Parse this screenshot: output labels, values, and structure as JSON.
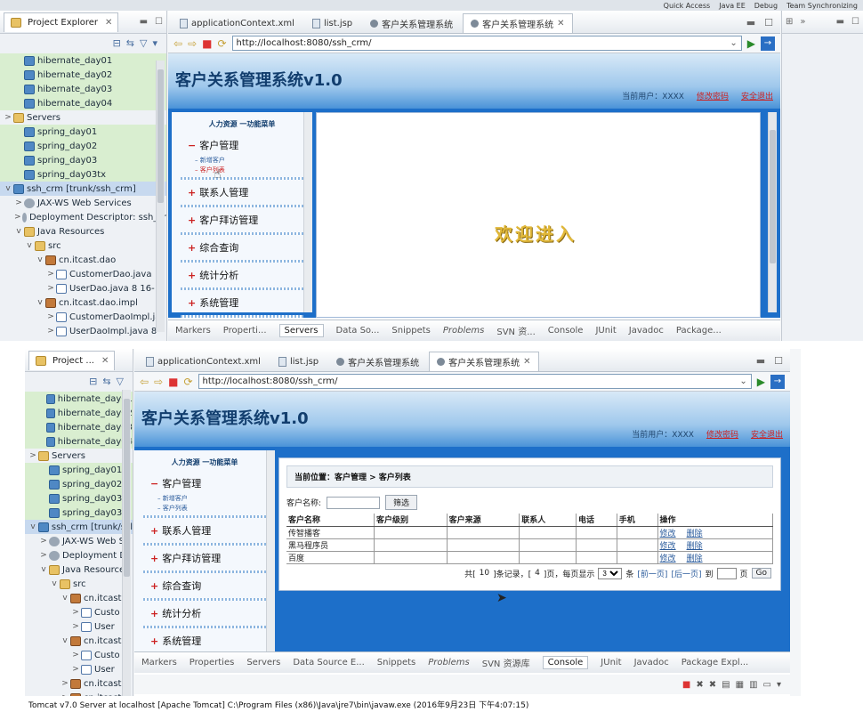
{
  "top_strip": {
    "quick_access": "Quick Access",
    "perspective1": "Java EE",
    "perspective2": "Debug",
    "perspective3": "Team Synchronizing"
  },
  "explorer": {
    "title1": "Project Explorer",
    "title2": "Project ...",
    "items": [
      {
        "label": "hibernate_day01",
        "depth": 1,
        "icon": "proj"
      },
      {
        "label": "hibernate_day02",
        "depth": 1,
        "icon": "proj"
      },
      {
        "label": "hibernate_day03",
        "depth": 1,
        "icon": "proj"
      },
      {
        "label": "hibernate_day04",
        "depth": 1,
        "icon": "proj"
      },
      {
        "label": "Servers",
        "depth": 0,
        "icon": "fold",
        "toggle": ">"
      },
      {
        "label": "spring_day01",
        "depth": 1,
        "icon": "proj"
      },
      {
        "label": "spring_day02",
        "depth": 1,
        "icon": "proj"
      },
      {
        "label": "spring_day03",
        "depth": 1,
        "icon": "proj"
      },
      {
        "label": "spring_day03tx",
        "depth": 1,
        "icon": "proj"
      },
      {
        "label": "ssh_crm [trunk/ssh_crm]",
        "depth": 0,
        "icon": "proj",
        "toggle": "v",
        "sel": true
      },
      {
        "label": "JAX-WS Web Services",
        "depth": 1,
        "icon": "gear",
        "toggle": ">"
      },
      {
        "label": "Deployment Descriptor: ssh_cr",
        "depth": 1,
        "icon": "gear",
        "toggle": ">"
      },
      {
        "label": "Java Resources",
        "depth": 1,
        "icon": "fold",
        "toggle": "v"
      },
      {
        "label": "src",
        "depth": 2,
        "icon": "fold",
        "toggle": "v"
      },
      {
        "label": "cn.itcast.dao",
        "depth": 3,
        "icon": "pkg",
        "toggle": "v"
      },
      {
        "label": "CustomerDao.java",
        "depth": 4,
        "icon": "java",
        "toggle": ">"
      },
      {
        "label": "UserDao.java 8  16-",
        "depth": 4,
        "icon": "java",
        "toggle": ">"
      },
      {
        "label": "cn.itcast.dao.impl",
        "depth": 3,
        "icon": "pkg",
        "toggle": "v"
      },
      {
        "label": "CustomerDaoImpl.ja",
        "depth": 4,
        "icon": "java",
        "toggle": ">"
      },
      {
        "label": "UserDaoImpl.java 8",
        "depth": 4,
        "icon": "java",
        "toggle": ">"
      },
      {
        "label": "cn.itcast.domain",
        "depth": 3,
        "icon": "pkg",
        "toggle": ">"
      }
    ],
    "items2": [
      {
        "label": "hibernate_day01",
        "depth": 1,
        "icon": "proj"
      },
      {
        "label": "hibernate_day02",
        "depth": 1,
        "icon": "proj"
      },
      {
        "label": "hibernate_day03",
        "depth": 1,
        "icon": "proj"
      },
      {
        "label": "hibernate_day04",
        "depth": 1,
        "icon": "proj"
      },
      {
        "label": "Servers",
        "depth": 0,
        "icon": "fold",
        "toggle": ">"
      },
      {
        "label": "spring_day01",
        "depth": 1,
        "icon": "proj"
      },
      {
        "label": "spring_day02",
        "depth": 1,
        "icon": "proj"
      },
      {
        "label": "spring_day03",
        "depth": 1,
        "icon": "proj"
      },
      {
        "label": "spring_day03tx",
        "depth": 1,
        "icon": "proj"
      },
      {
        "label": "ssh_crm [trunk/ssl",
        "depth": 0,
        "icon": "proj",
        "toggle": "v",
        "sel": true
      },
      {
        "label": "JAX-WS Web S",
        "depth": 1,
        "icon": "gear",
        "toggle": ">"
      },
      {
        "label": "Deployment D",
        "depth": 1,
        "icon": "gear",
        "toggle": ">"
      },
      {
        "label": "Java Resource",
        "depth": 1,
        "icon": "fold",
        "toggle": "v"
      },
      {
        "label": "src",
        "depth": 2,
        "icon": "fold",
        "toggle": "v"
      },
      {
        "label": "cn.itcast",
        "depth": 3,
        "icon": "pkg",
        "toggle": "v"
      },
      {
        "label": "Custo",
        "depth": 4,
        "icon": "java",
        "toggle": ">"
      },
      {
        "label": "User",
        "depth": 4,
        "icon": "java",
        "toggle": ">"
      },
      {
        "label": "cn.itcast",
        "depth": 3,
        "icon": "pkg",
        "toggle": "v"
      },
      {
        "label": "Custo",
        "depth": 4,
        "icon": "java",
        "toggle": ">"
      },
      {
        "label": "User",
        "depth": 4,
        "icon": "java",
        "toggle": ">"
      },
      {
        "label": "cn.itcast",
        "depth": 3,
        "icon": "pkg",
        "toggle": ">"
      },
      {
        "label": "cn.itcast",
        "depth": 3,
        "icon": "pkg",
        "toggle": ">"
      }
    ]
  },
  "editor": {
    "tabs": [
      {
        "label": "applicationContext.xml",
        "type": "doc"
      },
      {
        "label": "list.jsp",
        "type": "doc"
      },
      {
        "label": "客户关系管理系统",
        "type": "dot"
      },
      {
        "label": "客户关系管理系统",
        "type": "dot",
        "active": true
      }
    ],
    "url1": "http://localhost:8080/ssh_crm/",
    "url2": "http://localhost:8080/ssh_crm/"
  },
  "crm": {
    "title": "客户关系管理系统v1.0",
    "current_user": "当前用户：XXXX",
    "change_pwd": "修改密码",
    "logout": "安全退出",
    "menu_title": "人力资源 一功能菜单",
    "groups": [
      {
        "label": "客户管理",
        "sign": "−",
        "subs": [
          "新增客户",
          "客户列表"
        ]
      },
      {
        "label": "联系人管理",
        "sign": "+"
      },
      {
        "label": "客户拜访管理",
        "sign": "+"
      },
      {
        "label": "综合查询",
        "sign": "+"
      },
      {
        "label": "统计分析",
        "sign": "+"
      },
      {
        "label": "系统管理",
        "sign": "+"
      }
    ],
    "welcome": "欢迎进入",
    "crumb": "当前位置：客户管理 > 客户列表",
    "search_label": "客户名称:",
    "search_btn": "筛选",
    "columns": [
      "客户名称",
      "客户级别",
      "客户来源",
      "联系人",
      "电话",
      "手机",
      "操作"
    ],
    "rows": [
      {
        "name": "传智播客",
        "edit": "修改",
        "del": "删除"
      },
      {
        "name": "黑马程序员",
        "edit": "修改",
        "del": "删除"
      },
      {
        "name": "百度",
        "edit": "修改",
        "del": "删除"
      }
    ],
    "pager": {
      "prefix": "共[",
      "total": "10",
      "mid": "]条记录，[",
      "pages": "4",
      "suffix": "]页，每页显示",
      "per_page": "3",
      "unit": "条",
      "first": "[前一页]",
      "next": "[后一页]",
      "goto": "到",
      "page_unit": "页",
      "go": "Go"
    }
  },
  "bottom_tabs1": [
    "Markers",
    "Properti...",
    "Servers",
    "Data So...",
    "Snippets",
    "Problems",
    "SVN 资...",
    "Console",
    "JUnit",
    "Javadoc",
    "Package..."
  ],
  "bottom_tabs2": [
    "Markers",
    "Properties",
    "Servers",
    "Data Source E...",
    "Snippets",
    "Problems",
    "SVN 资源库",
    "Console",
    "JUnit",
    "Javadoc",
    "Package Expl..."
  ],
  "console_line": "Tomcat v7.0 Server at localhost [Apache Tomcat] C:\\Program Files (x86)\\Java\\jre7\\bin\\javaw.exe (2016年9月23日 下午4:07:15)"
}
